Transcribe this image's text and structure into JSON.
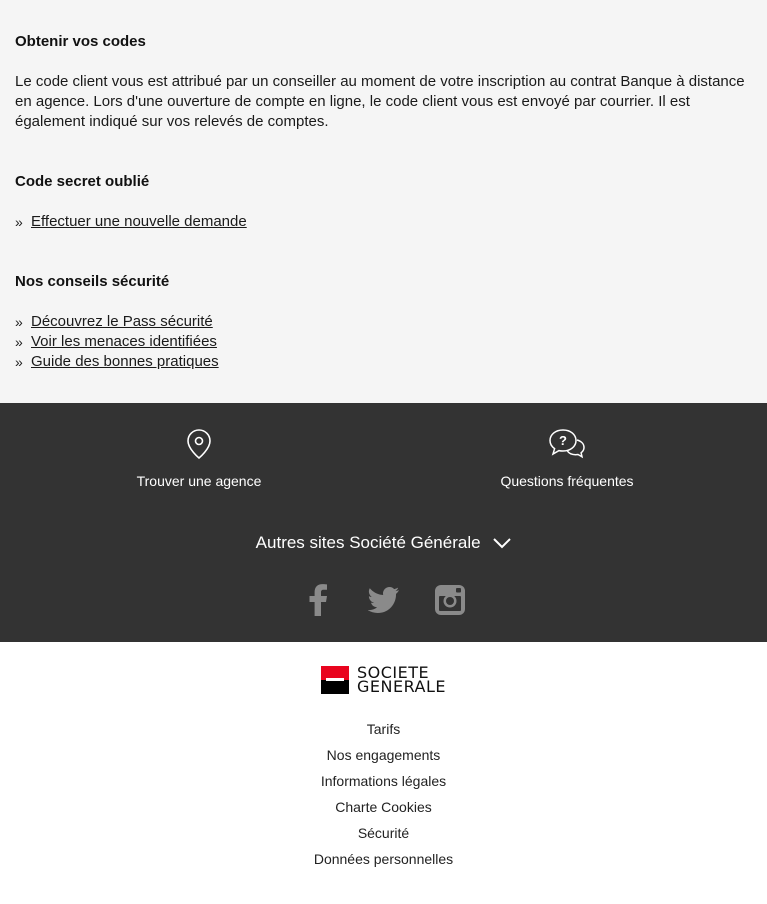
{
  "codes": {
    "title": "Obtenir vos codes",
    "text": "Le code client vous est attribué par un conseiller au moment de votre inscription au contrat Banque à distance en agence. Lors d'une ouverture de compte en ligne, le code client vous est envoyé par courrier. Il est également indiqué sur vos relevés de comptes."
  },
  "forgot": {
    "title": "Code secret oublié",
    "links": [
      {
        "label": "Effectuer une nouvelle demande"
      }
    ]
  },
  "security": {
    "title": "Nos conseils sécurité",
    "links": [
      {
        "label": "Découvrez le Pass sécurité"
      },
      {
        "label": "Voir les menaces identifiées"
      },
      {
        "label": "Guide des bonnes pratiques"
      }
    ]
  },
  "quick_links": [
    {
      "label": "Trouver une agence",
      "icon": "map-pin-icon"
    },
    {
      "label": "Questions fréquentes",
      "icon": "chat-question-icon"
    }
  ],
  "other_sites": "Autres sites Société Générale",
  "social": [
    "facebook-icon",
    "twitter-icon",
    "instagram-icon"
  ],
  "logo": {
    "line1": "SOCIETE",
    "line2": "GENERALE"
  },
  "legal_links": [
    "Tarifs",
    "Nos engagements",
    "Informations légales",
    "Charte Cookies",
    "Sécurité",
    "Données personnelles"
  ],
  "colors": {
    "dark_footer": "#333333",
    "brand_red": "#e9041e",
    "light_bg": "#f5f5f5"
  }
}
